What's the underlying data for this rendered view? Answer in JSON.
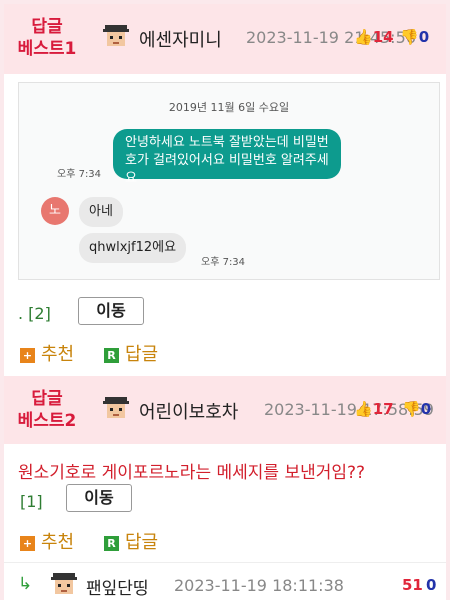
{
  "posts": [
    {
      "best_label": "답글\n베스트1",
      "nickname": "에센자미니",
      "date": "2023-11-19 21:45:56",
      "upvotes": "14",
      "downvotes": "0",
      "bracket": ". [2]",
      "move_label": "이동",
      "recommend_label": "추천",
      "reply_label": "답글"
    },
    {
      "best_label": "답글\n베스트2",
      "nickname": "어린이보호차",
      "date": "2023-11-19 17:58:59",
      "upvotes": "17",
      "downvotes": "0",
      "text": "원소기호로 게이포르노라는 메세지를 보낸거임??",
      "bracket": "[1]",
      "move_label": "이동",
      "recommend_label": "추천",
      "reply_label": "답글"
    }
  ],
  "chat": {
    "date": "2019년 11월 6일 수요일",
    "out_message": "안녕하세요 노트북 잘받았는데 비밀번호가 걸려있어서요 비밀번호 알려주세요",
    "out_time": "오후 7:34",
    "avatar_text": "노",
    "in_message_1": "아네",
    "in_message_2": "qhwlxjf12에요",
    "in_time": "오후 7:34"
  },
  "reply_row": {
    "nickname": "팬잎단띵",
    "date": "2023-11-19 18:11:38",
    "upvotes": "51",
    "downvotes": "0"
  },
  "icons": {
    "upvote": "thumbs-up-icon",
    "downvote": "thumbs-down-icon",
    "recommend": "plus-square-icon",
    "reply": "r-square-icon",
    "reply_arrow": "reply-arrow-icon"
  }
}
